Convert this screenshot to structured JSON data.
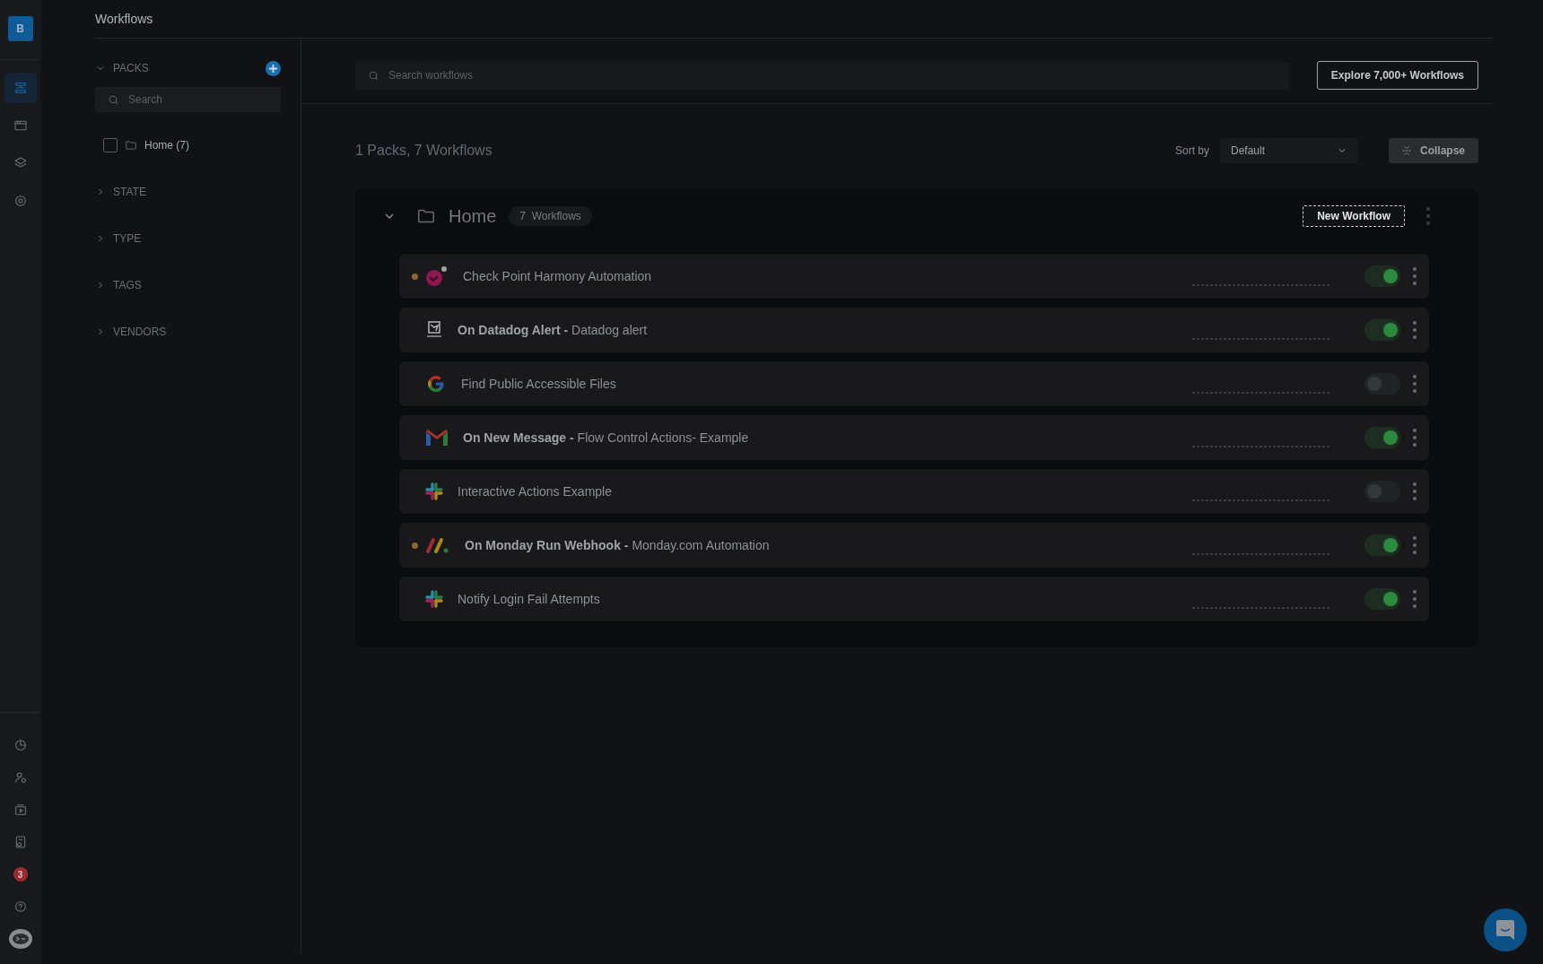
{
  "rail": {
    "avatar": "B",
    "nav": [
      {
        "selected": true
      },
      {
        "selected": false
      },
      {
        "selected": false
      },
      {
        "selected": false
      }
    ],
    "notification_badge": "3"
  },
  "header": {
    "title": "Workflows"
  },
  "filters": {
    "packs": {
      "label": "PACKS",
      "expanded": true,
      "search_placeholder": "Search",
      "items": [
        {
          "label": "Home (7)",
          "checked": false
        }
      ]
    },
    "sections": [
      {
        "label": "STATE",
        "expanded": false
      },
      {
        "label": "TYPE",
        "expanded": false
      },
      {
        "label": "TAGS",
        "expanded": false
      },
      {
        "label": "VENDORS",
        "expanded": false
      }
    ]
  },
  "search": {
    "placeholder": "Search workflows"
  },
  "explore_button": "Explore 7,000+ Workflows",
  "summary": "1 Packs, 7 Workflows",
  "sort": {
    "label": "Sort by",
    "value": "Default"
  },
  "collapse_button": "Collapse",
  "pack": {
    "name": "Home",
    "expanded": true,
    "count": "7",
    "count_label": "Workflows",
    "new_button": "New Workflow",
    "workflows": [
      {
        "title": "Check Point Harmony Automation",
        "kind": "ball",
        "status_dot": true,
        "enabled": true
      },
      {
        "title": "**On Datadog Alert -** Datadog alert",
        "kind": "dog",
        "status_dot": false,
        "enabled": true
      },
      {
        "title": "Find Public Accessible Files",
        "kind": "gletter",
        "status_dot": false,
        "enabled": false
      },
      {
        "title": "**On New Message -** Flow Control Actions- Example",
        "kind": "mail",
        "status_dot": false,
        "enabled": true
      },
      {
        "title": "Interactive Actions Example",
        "kind": "hash",
        "status_dot": false,
        "enabled": false
      },
      {
        "title": "**On Monday Run Webhook -** Monday.com Automation",
        "kind": "strokes",
        "status_dot": true,
        "enabled": true
      },
      {
        "title": "Notify Login Fail Attempts",
        "kind": "hash",
        "status_dot": false,
        "enabled": true
      }
    ]
  }
}
